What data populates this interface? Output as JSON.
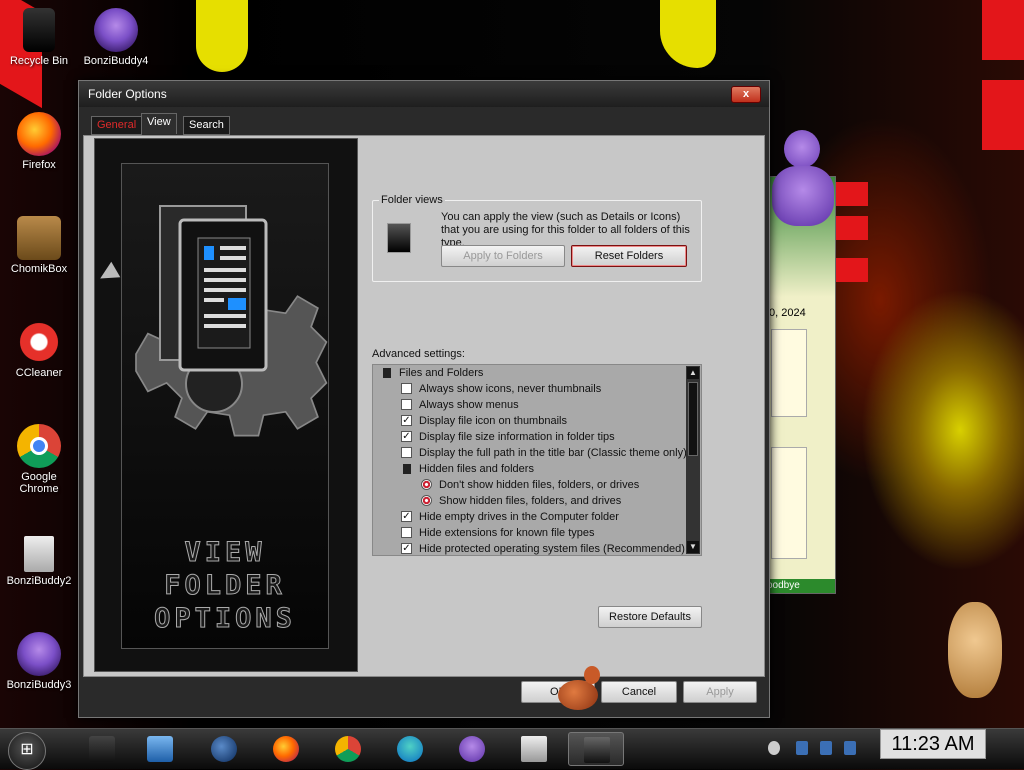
{
  "desktop": {
    "icons": [
      {
        "label": "Recycle Bin",
        "icon": "recycle-bin-icon"
      },
      {
        "label": "BonziBuddy4",
        "icon": "bonzibuddy-icon"
      },
      {
        "label": "Firefox",
        "icon": "firefox-icon"
      },
      {
        "label": "ChomikBox",
        "icon": "chomikbox-icon"
      },
      {
        "label": "CCleaner",
        "icon": "ccleaner-icon"
      },
      {
        "label": "Google Chrome",
        "icon": "chrome-icon"
      },
      {
        "label": "BonziBuddy2",
        "icon": "folder-icon"
      },
      {
        "label": "BonziBuddy3",
        "icon": "bonzibuddy-icon"
      }
    ]
  },
  "dialog": {
    "title": "Folder Options",
    "close_label": "x",
    "tabs": [
      {
        "label": "General",
        "active": false
      },
      {
        "label": "View",
        "active": true
      },
      {
        "label": "Search",
        "active": false
      }
    ],
    "art_title": "VIEW FOLDER OPTIONS",
    "folder_views": {
      "legend": "Folder views",
      "description": "You can apply the view (such as Details or Icons) that you are using for this folder to all folders of this type.",
      "apply_to_folders": "Apply to Folders",
      "reset_folders": "Reset Folders"
    },
    "advanced_label": "Advanced settings:",
    "advanced_items": [
      {
        "type": "folder",
        "label": "Files and Folders",
        "checked": false
      },
      {
        "type": "checkbox",
        "label": "Always show icons, never thumbnails",
        "checked": false
      },
      {
        "type": "checkbox",
        "label": "Always show menus",
        "checked": false
      },
      {
        "type": "checkbox",
        "label": "Display file icon on thumbnails",
        "checked": true
      },
      {
        "type": "checkbox",
        "label": "Display file size information in folder tips",
        "checked": true
      },
      {
        "type": "checkbox",
        "label": "Display the full path in the title bar (Classic theme only)",
        "checked": false
      },
      {
        "type": "folder",
        "label": "Hidden files and folders",
        "checked": false
      },
      {
        "type": "radio",
        "label": "Don't show hidden files, folders, or drives",
        "checked": false
      },
      {
        "type": "radio",
        "label": "Show hidden files, folders, and drives",
        "checked": true
      },
      {
        "type": "checkbox",
        "label": "Hide empty drives in the Computer folder",
        "checked": true
      },
      {
        "type": "checkbox",
        "label": "Hide extensions for known file types",
        "checked": false
      },
      {
        "type": "checkbox",
        "label": "Hide protected operating system files (Recommended)",
        "checked": true
      }
    ],
    "restore_defaults": "Restore Defaults",
    "ok": "OK",
    "cancel": "Cancel",
    "apply": "Apply"
  },
  "background_window": {
    "date_fragment": "0, 2024",
    "bottom_fragment": "oodbye"
  },
  "taskbar": {
    "start_label": "⊞",
    "clock": "11:23 AM"
  }
}
